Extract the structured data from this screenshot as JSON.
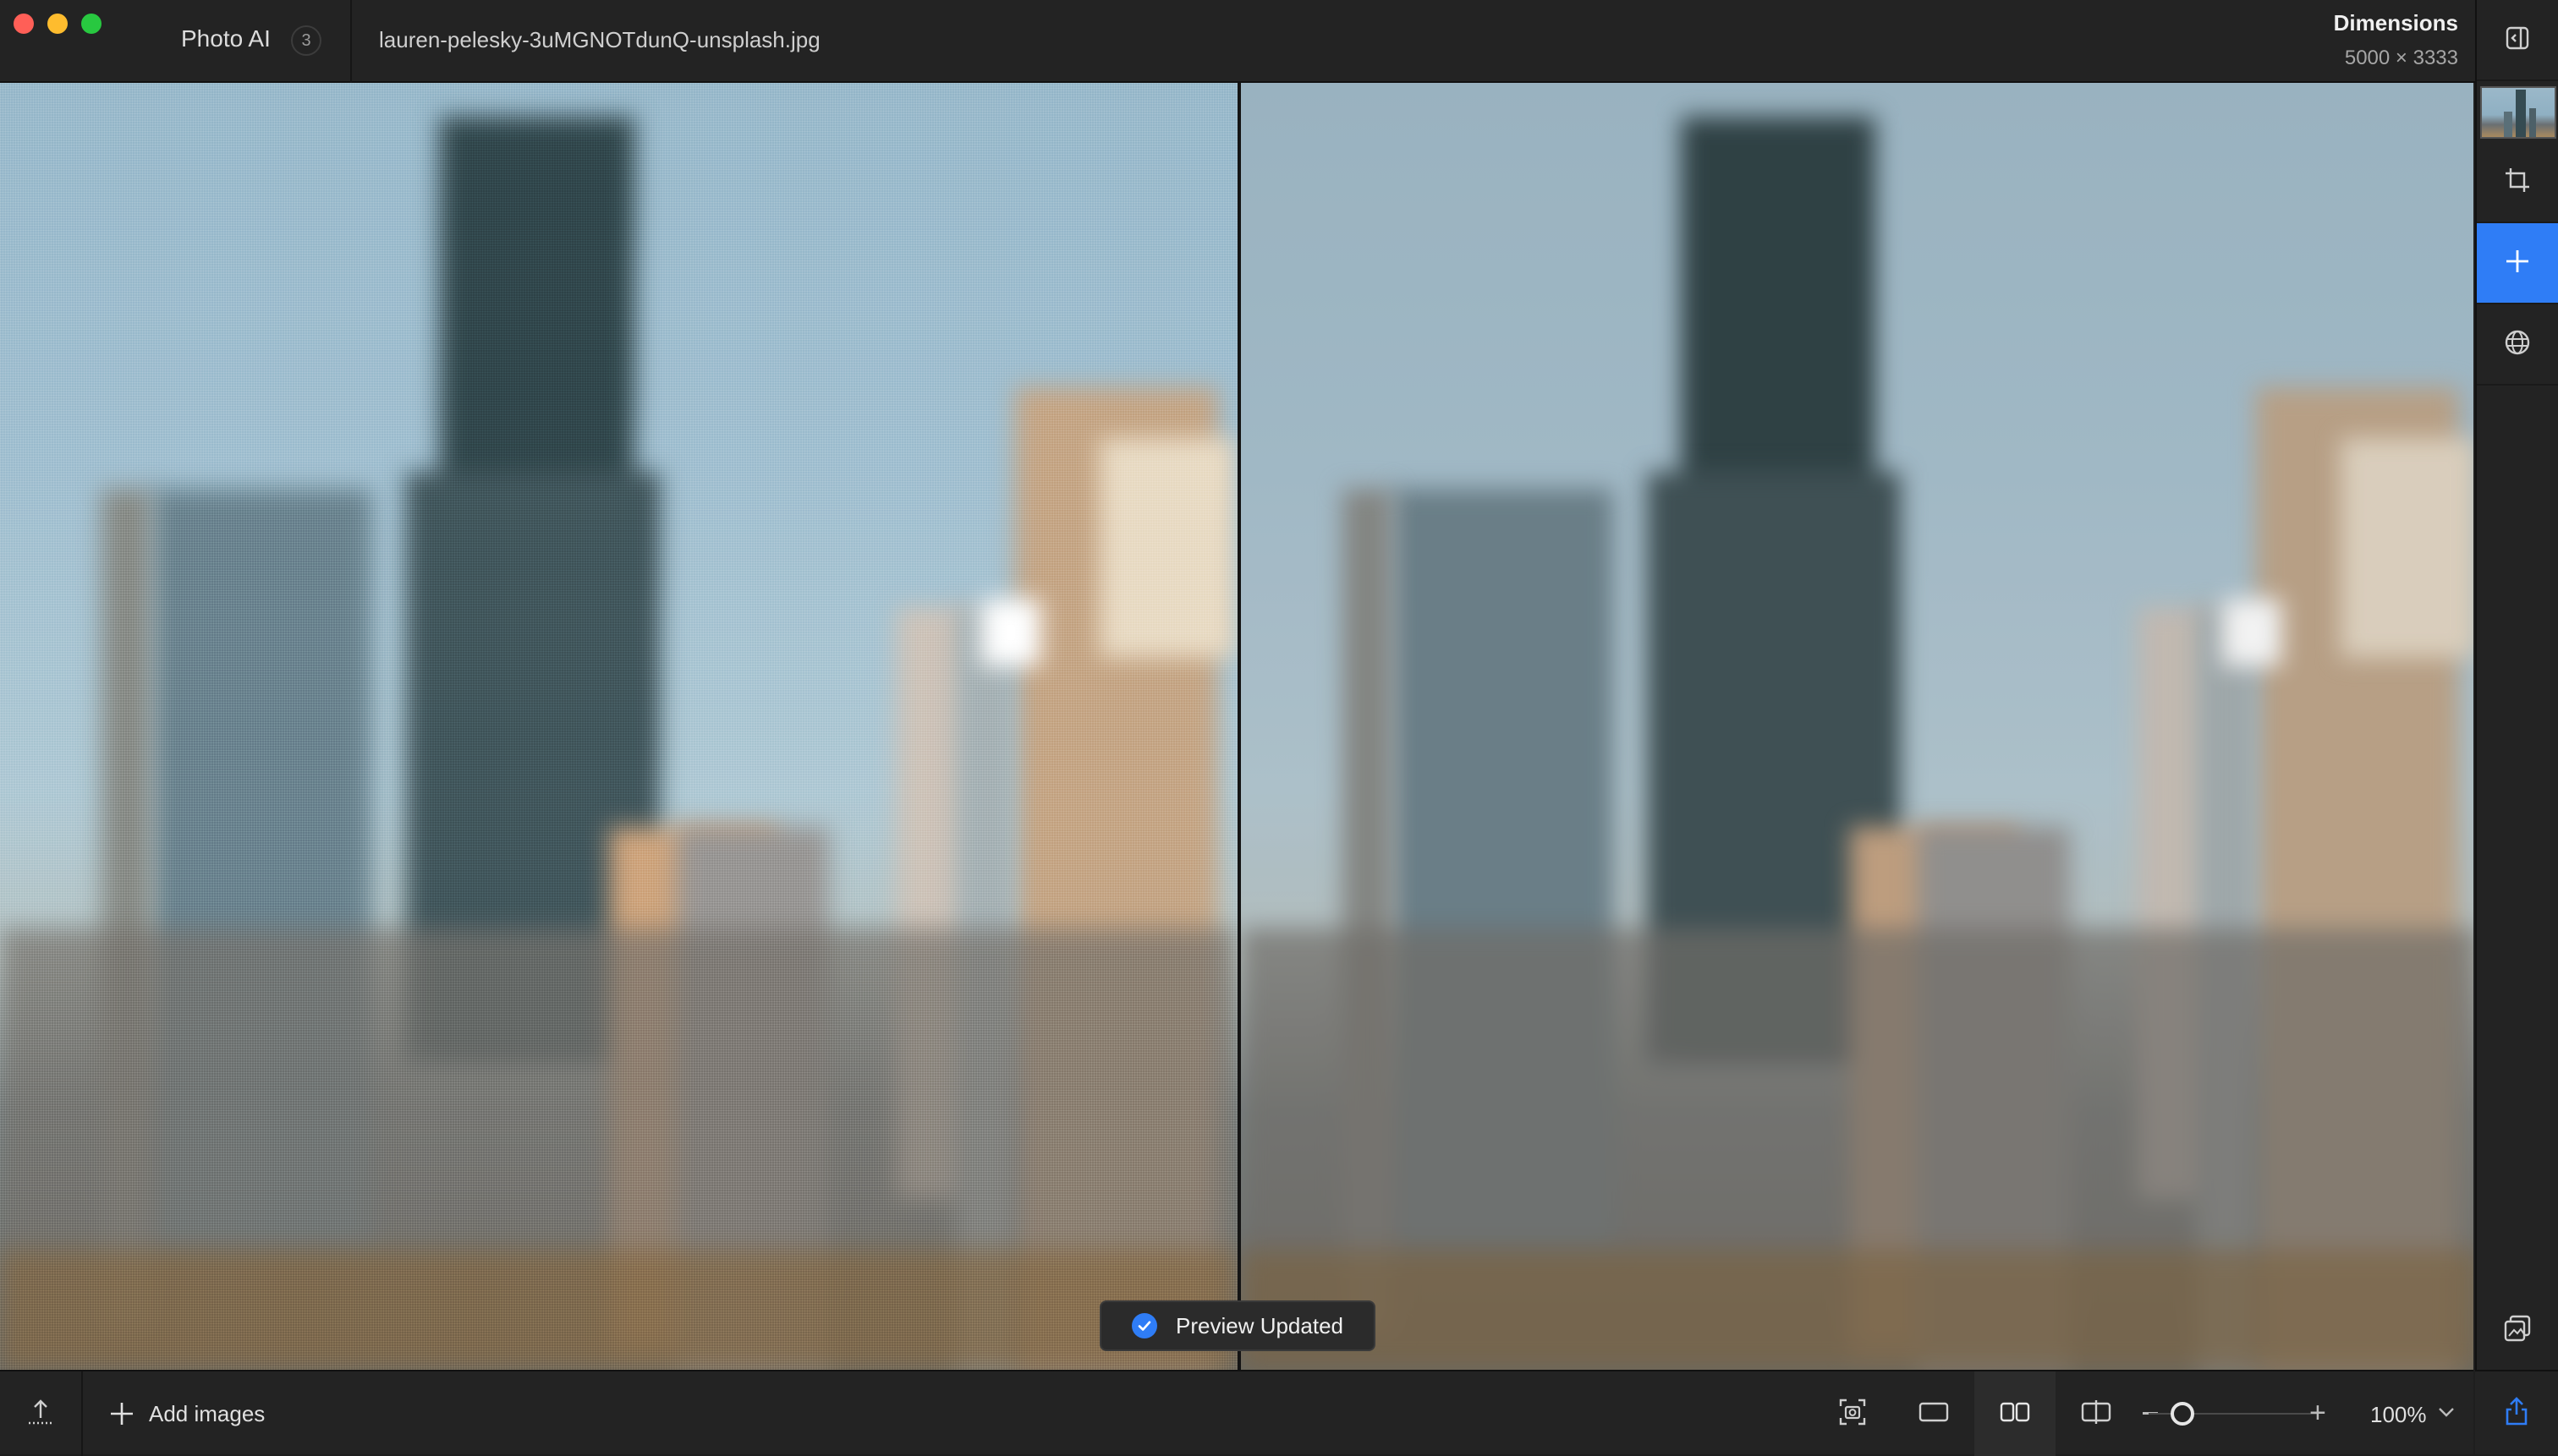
{
  "window": {
    "app_name": "Photo AI",
    "image_count": "3",
    "filename": "lauren-pelesky-3uMGNOTdunQ-unsplash.jpg"
  },
  "dimensions": {
    "label": "Dimensions",
    "value": "5000 × 3333"
  },
  "toast": {
    "message": "Preview Updated"
  },
  "bottombar": {
    "add_images_label": "Add images",
    "zoom_level": "100%",
    "zoom_fraction": 0.13
  },
  "colors": {
    "accent": "#2f7df6",
    "background": "#1e1e1e",
    "panel": "#232323"
  },
  "icons": {
    "sidebar": [
      "sidebar-toggle-icon",
      "crop-icon",
      "plus-icon",
      "globe-icon",
      "compare-layers-icon"
    ],
    "bottom": [
      "upload-icon",
      "plus-icon",
      "screenshot-icon",
      "single-view-icon",
      "side-by-side-icon",
      "split-view-icon",
      "chevron-down-icon",
      "share-icon"
    ]
  }
}
